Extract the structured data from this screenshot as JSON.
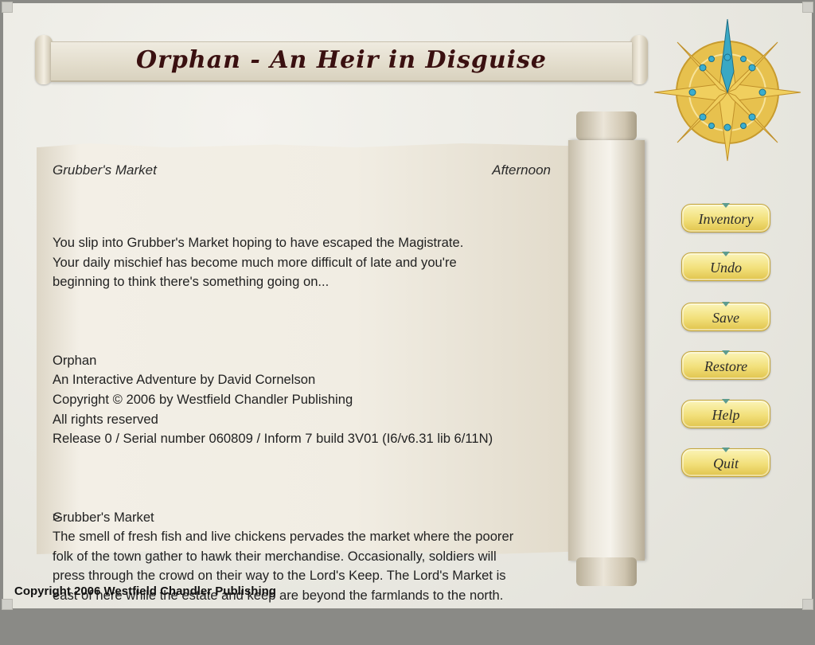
{
  "window": {
    "title": "Orphan - An Heir in Disguise"
  },
  "status": {
    "location": "Grubber's Market",
    "time": "Afternoon"
  },
  "story": {
    "paragraphs": [
      "You slip into Grubber's Market hoping to have escaped the Magistrate.\nYour daily mischief has become much more difficult of late and you're\nbeginning to think there's something going on...",
      "Orphan\nAn Interactive Adventure by David Cornelson\nCopyright © 2006 by Westfield Chandler Publishing\nAll rights reserved\nRelease 0 / Serial number 060809 / Inform 7 build 3V01 (I6/v6.31 lib 6/11N)",
      "Grubber's Market\nThe smell of fresh fish and live chickens pervades the market where the poorer\nfolk of the town gather to hawk their merchandise. Occasionally, soldiers will\npress through the crowd on their way to the Lord's Keep. The Lord's Market is\neast of here while the estate and keep are beyond the farmlands to the north."
    ],
    "prompt": ">"
  },
  "buttons": {
    "inventory": "Inventory",
    "undo": "Undo",
    "save": "Save",
    "restore": "Restore",
    "help": "Help",
    "quit": "Quit"
  },
  "footer": {
    "copyright": "Copyright 2006 Westfield Chandler Publishing"
  },
  "colors": {
    "button_gold": "#f2e07a",
    "compass_gold": "#e7c14e",
    "compass_teal": "#3aaed0",
    "title_ink": "#3a1010"
  },
  "icons": {
    "compass": "compass-rose-icon"
  }
}
